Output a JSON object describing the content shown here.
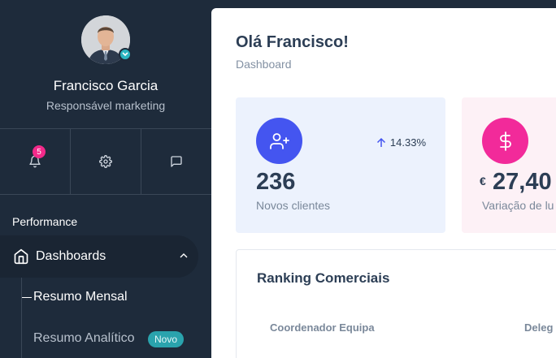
{
  "user": {
    "name": "Francisco Garcia",
    "role": "Responsável marketing"
  },
  "quick_actions": {
    "notifications_count": "5"
  },
  "nav": {
    "section_title": "Performance",
    "active_item": "Dashboards",
    "sub_items": [
      {
        "label": "Resumo Mensal"
      },
      {
        "label": "Resumo Analítico",
        "badge": "Novo"
      }
    ]
  },
  "header": {
    "greeting": "Olá Francisco!",
    "breadcrumb": "Dashboard"
  },
  "stats": [
    {
      "value": "236",
      "label": "Novos clientes",
      "trend": "14.33%",
      "accent": "#4455f0"
    },
    {
      "currency": "€",
      "value": "27,40",
      "label": "Variação de lu",
      "accent": "#f22a9a"
    }
  ],
  "ranking": {
    "title": "Ranking Comerciais",
    "columns": [
      "Coordenador Equipa",
      "Deleg"
    ]
  }
}
